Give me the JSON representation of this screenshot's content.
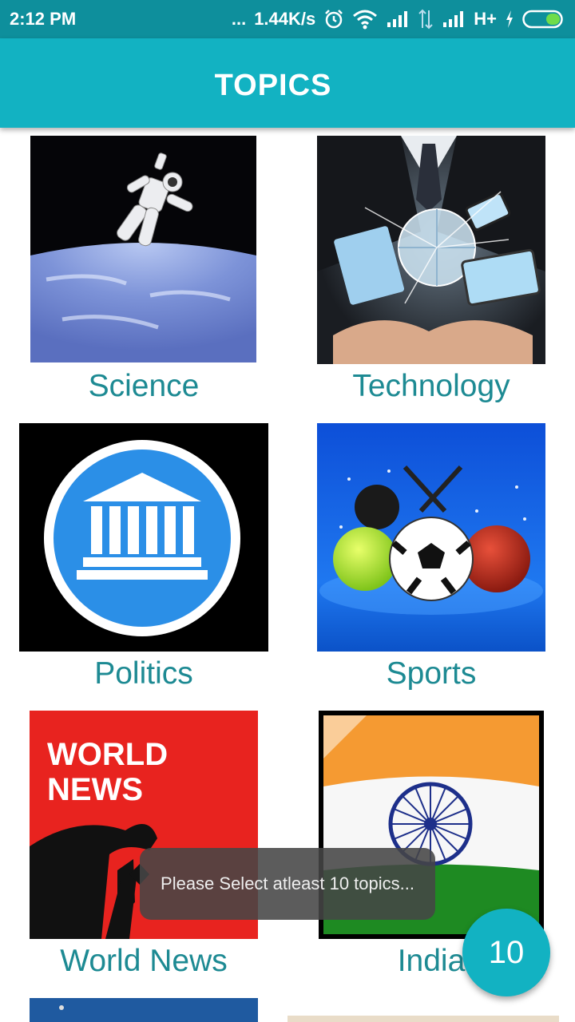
{
  "status_bar": {
    "time": "2:12 PM",
    "dots": "...",
    "speed": "1.44K/s",
    "network": "H+",
    "icons": [
      "alarm-icon",
      "wifi-icon",
      "signal-icon",
      "data-transfer-icon",
      "signal-icon",
      "charging-icon",
      "battery-icon"
    ]
  },
  "app_bar": {
    "title": "TOPICS"
  },
  "topics": [
    {
      "label": "Science"
    },
    {
      "label": "Technology"
    },
    {
      "label": "Politics"
    },
    {
      "label": "Sports"
    },
    {
      "label": "World News",
      "image_text": [
        "WORLD",
        "NEWS"
      ]
    },
    {
      "label": "India"
    }
  ],
  "toast": {
    "message": "Please Select atleast 10 topics..."
  },
  "fab": {
    "count": "10"
  },
  "colors": {
    "primary": "#12b2c2",
    "primary_dark": "#0e8f9c",
    "label": "#1d8a93"
  }
}
